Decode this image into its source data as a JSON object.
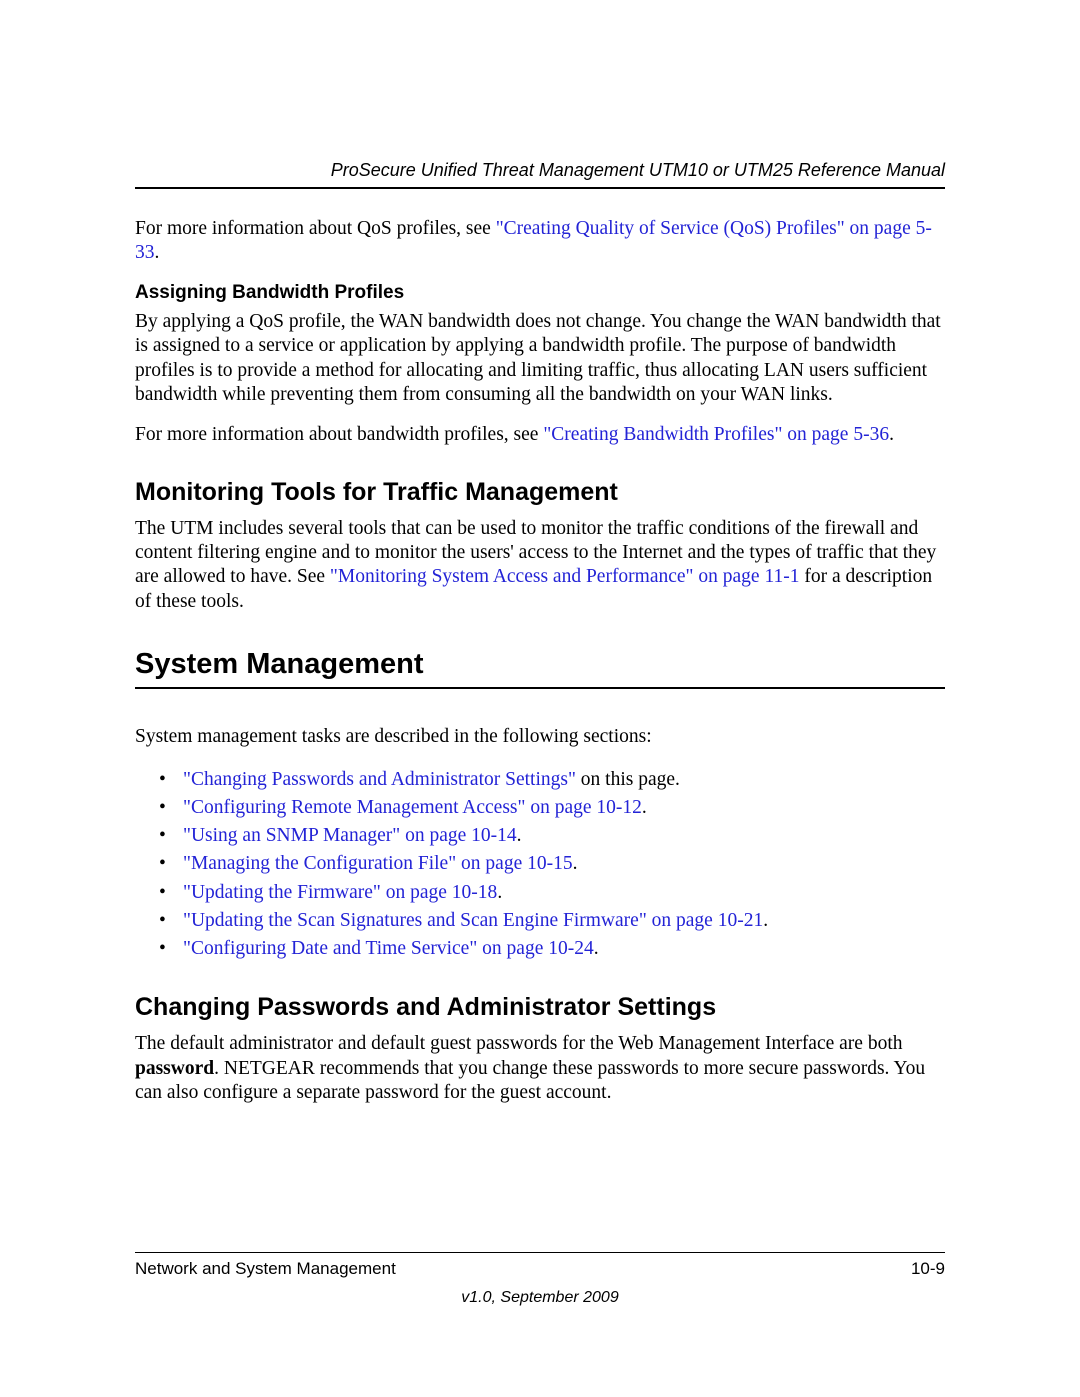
{
  "header": {
    "title": "ProSecure Unified Threat Management UTM10 or UTM25 Reference Manual"
  },
  "p1": {
    "pre": "For more information about QoS profiles, see ",
    "link": "\"Creating Quality of Service (QoS) Profiles\" on page 5-33",
    "post": "."
  },
  "subheading1": "Assigning Bandwidth Profiles",
  "p2": "By applying a QoS profile, the WAN bandwidth does not change. You change the WAN bandwidth that is assigned to a service or application by applying a bandwidth profile. The purpose of bandwidth profiles is to provide a method for allocating and limiting traffic, thus allocating LAN users sufficient bandwidth while preventing them from consuming all the bandwidth on your WAN links.",
  "p3": {
    "pre": "For more information about bandwidth profiles, see ",
    "link": "\"Creating Bandwidth Profiles\" on page 5-36",
    "post": "."
  },
  "h2a": "Monitoring Tools for Traffic Management",
  "p4": {
    "pre": "The UTM includes several tools that can be used to monitor the traffic conditions of the firewall and content filtering engine and to monitor the users' access to the Internet and the types of traffic that they are allowed to have. See ",
    "link": "\"Monitoring System Access and Performance\" on page 11-1",
    "post": " for a description of these tools."
  },
  "h1": "System Management",
  "p5": "System management tasks are described in the following sections:",
  "toc": [
    {
      "link": "\"Changing Passwords and Administrator Settings\"",
      "post": " on this page."
    },
    {
      "link": "\"Configuring Remote Management Access\" on page 10-12",
      "post": "."
    },
    {
      "link": "\"Using an SNMP Manager\" on page 10-14",
      "post": "."
    },
    {
      "link": "\"Managing the Configuration File\" on page 10-15",
      "post": "."
    },
    {
      "link": "\"Updating the Firmware\" on page 10-18",
      "post": "."
    },
    {
      "link": "\"Updating the Scan Signatures and Scan Engine Firmware\" on page 10-21",
      "post": "."
    },
    {
      "link": "\"Configuring Date and Time Service\" on page 10-24",
      "post": "."
    }
  ],
  "h2b": "Changing Passwords and Administrator Settings",
  "p6": {
    "pre": "The default administrator and default guest passwords for the Web Management Interface are both ",
    "bold": "password",
    "post": ". NETGEAR recommends that you change these passwords to more secure passwords. You can also configure a separate password for the guest account."
  },
  "footer": {
    "left": "Network and System Management",
    "right": "10-9",
    "version": "v1.0, September 2009"
  }
}
